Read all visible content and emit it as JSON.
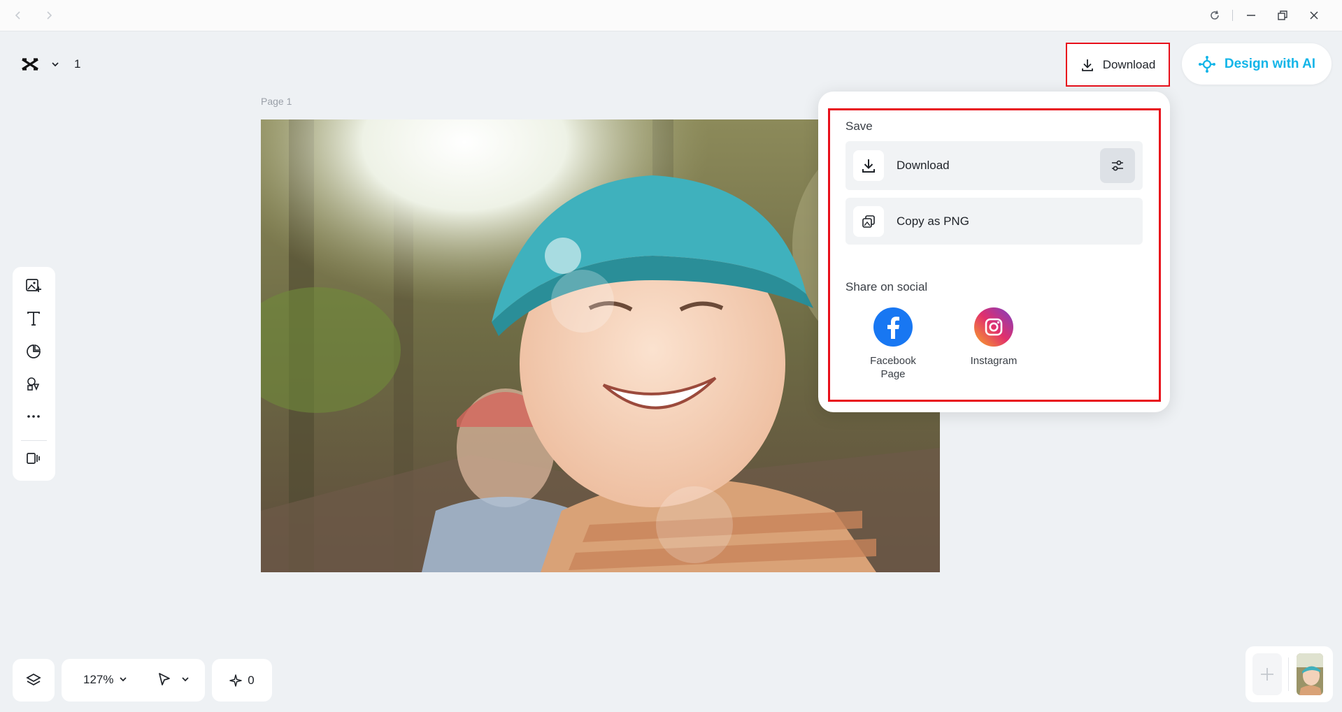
{
  "titlebar": {
    "back_icon": "chevron-left-icon",
    "forward_icon": "chevron-right-icon",
    "refresh_icon": "refresh-icon",
    "minimize_icon": "minimize-icon",
    "restore_icon": "restore-icon",
    "close_icon": "close-icon"
  },
  "header": {
    "logo_icon": "capcut-logo-icon",
    "page_count": "1",
    "download_label": "Download",
    "design_ai_label": "Design with AI"
  },
  "canvas": {
    "page_label": "Page 1"
  },
  "dropdown": {
    "save_label": "Save",
    "download_label": "Download",
    "copy_png_label": "Copy as PNG",
    "share_label": "Share on social",
    "social": [
      {
        "name": "Facebook Page",
        "line1": "Facebook",
        "line2": "Page",
        "color": "#1877f2"
      },
      {
        "name": "Instagram",
        "line1": "Instagram",
        "line2": "",
        "color": "#e1306c"
      }
    ]
  },
  "bottom": {
    "zoom": "127%",
    "credits": "0"
  },
  "colors": {
    "accent": "#13b5e8",
    "highlight": "#e8101b",
    "background": "#eef1f4"
  }
}
